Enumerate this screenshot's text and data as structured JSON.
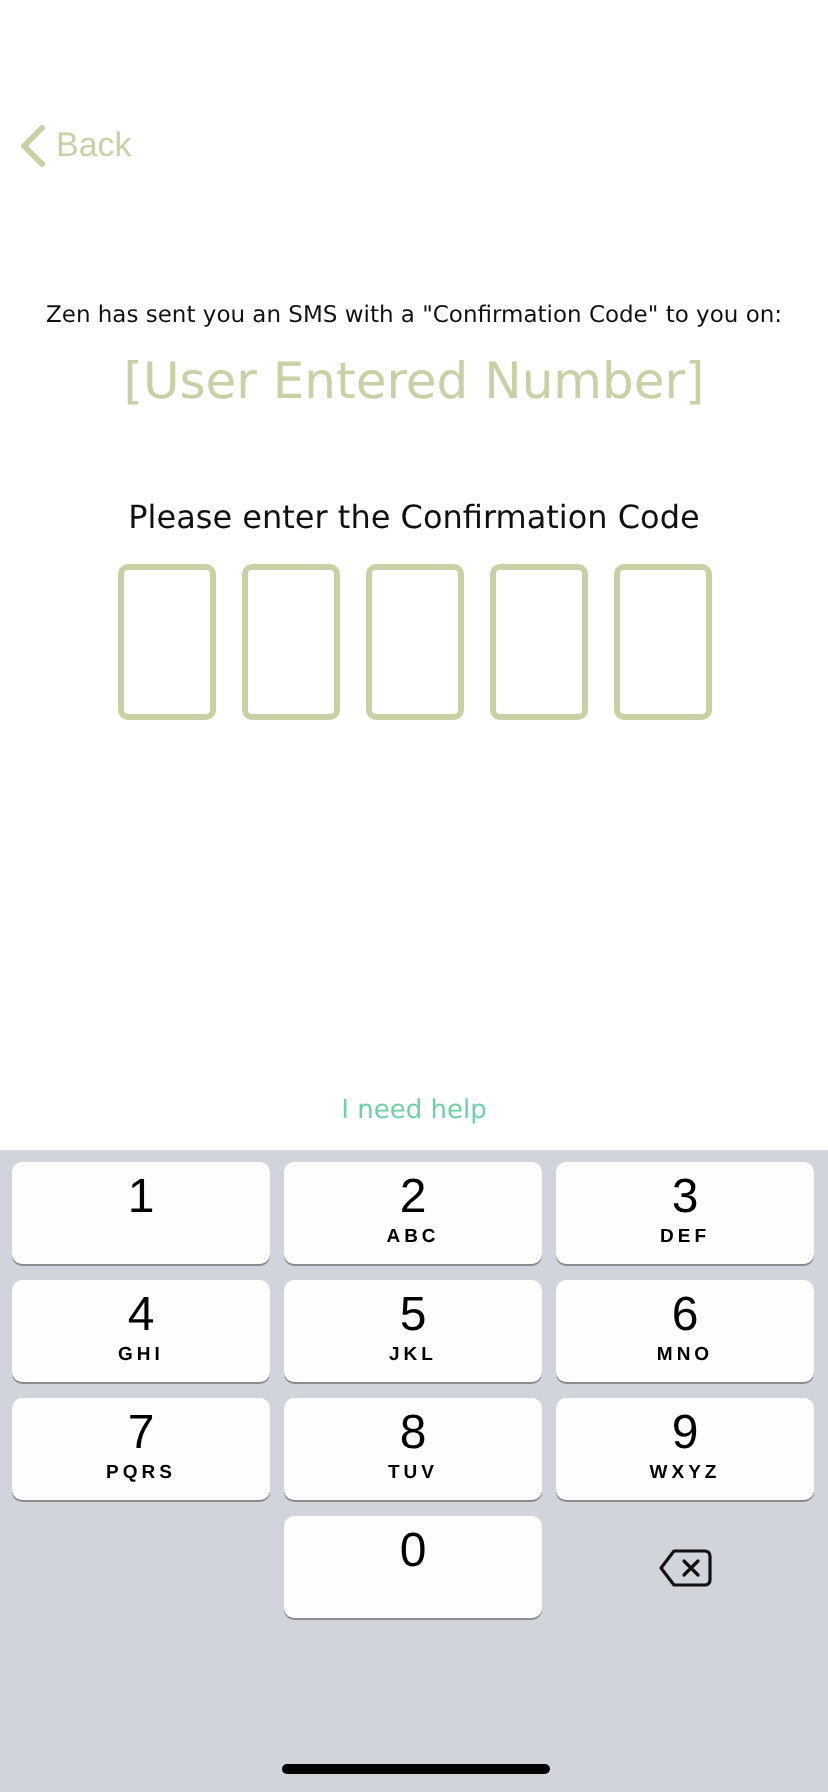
{
  "back": {
    "label": "Back"
  },
  "message": "Zen has sent you an SMS with a \"Confirmation Code\" to you on:",
  "phone_number": "[User Entered Number]",
  "prompt": "Please enter the Confirmation Code",
  "code_boxes": [
    {
      "kind": "digit"
    },
    {
      "kind": "digit"
    },
    {
      "kind": "digit"
    },
    {
      "kind": "digit"
    },
    {
      "kind": "digit"
    }
  ],
  "help_link": "I need help",
  "keypad": [
    {
      "kind": "digit",
      "digit": "1"
    },
    {
      "kind": "digit",
      "digit": "2",
      "letters": "ABC"
    },
    {
      "kind": "digit",
      "digit": "3",
      "letters": "DEF"
    },
    {
      "kind": "digit",
      "digit": "4",
      "letters": "GHI"
    },
    {
      "kind": "digit",
      "digit": "5",
      "letters": "JKL"
    },
    {
      "kind": "digit",
      "digit": "6",
      "letters": "MNO"
    },
    {
      "kind": "digit",
      "digit": "7",
      "letters": "PQRS"
    },
    {
      "kind": "digit",
      "digit": "8",
      "letters": "TUV"
    },
    {
      "kind": "digit",
      "digit": "9",
      "letters": "WXYZ"
    },
    {
      "kind": "blank"
    },
    {
      "kind": "digit",
      "digit": "0"
    },
    {
      "kind": "delete"
    }
  ]
}
